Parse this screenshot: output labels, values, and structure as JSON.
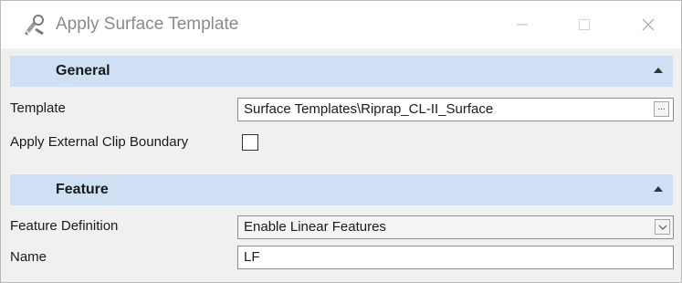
{
  "window": {
    "title": "Apply Surface Template",
    "controls": {
      "minimize": "minimize",
      "maximize": "maximize",
      "close": "close"
    }
  },
  "sections": {
    "general": {
      "title": "General",
      "template_label": "Template",
      "template_value": "Surface Templates\\Riprap_CL-II_Surface",
      "template_browse": "...",
      "clip_label": "Apply External Clip Boundary",
      "clip_checked": false
    },
    "feature": {
      "title": "Feature",
      "definition_label": "Feature Definition",
      "definition_value": "Enable Linear Features",
      "name_label": "Name",
      "name_value": "LF"
    }
  },
  "colors": {
    "section_header_bg": "#cfe0f5",
    "window_bg": "#f0f0f0",
    "field_border": "#8d8d8d"
  },
  "icons": {
    "app": "tools-icon",
    "collapse": "chevron-up-icon",
    "dropdown": "chevron-down-icon"
  }
}
